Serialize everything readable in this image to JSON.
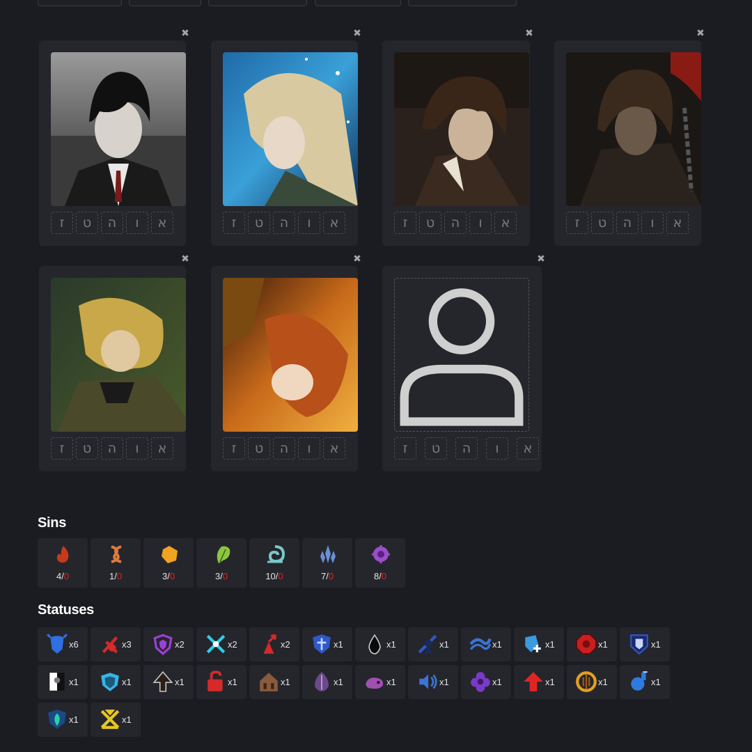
{
  "party": {
    "slot_letters": [
      "ז",
      "ט",
      "ה",
      "ו",
      "א"
    ],
    "cards": [
      {
        "name": "identity-1",
        "has_portrait": true,
        "art": "dark-suit"
      },
      {
        "name": "identity-2",
        "has_portrait": true,
        "art": "starry-blonde"
      },
      {
        "name": "identity-3",
        "has_portrait": true,
        "art": "brown-hair"
      },
      {
        "name": "identity-4",
        "has_portrait": true,
        "art": "chains"
      },
      {
        "name": "identity-5",
        "has_portrait": true,
        "art": "blonde-green"
      },
      {
        "name": "identity-6",
        "has_portrait": true,
        "art": "fire-orange"
      },
      {
        "name": "identity-7",
        "has_portrait": false,
        "art": "empty"
      }
    ]
  },
  "sins": {
    "title": "Sins",
    "items": [
      {
        "icon": "wrath-icon",
        "have": "4",
        "need": "0",
        "color": "#c6391a"
      },
      {
        "icon": "lust-icon",
        "have": "1",
        "need": "0",
        "color": "#e07a3c"
      },
      {
        "icon": "sloth-icon",
        "have": "3",
        "need": "0",
        "color": "#f0a321"
      },
      {
        "icon": "gluttony-icon",
        "have": "3",
        "need": "0",
        "color": "#8cc63f"
      },
      {
        "icon": "gloom-icon",
        "have": "10",
        "need": "0",
        "color": "#79c8c8"
      },
      {
        "icon": "pride-icon",
        "have": "7",
        "need": "0",
        "color": "#6a8fd6"
      },
      {
        "icon": "envy-icon",
        "have": "8",
        "need": "0",
        "color": "#9b4ec9"
      }
    ]
  },
  "statuses": {
    "title": "Statuses",
    "items": [
      {
        "icon": "blue-beast-icon",
        "count": "x6",
        "color": "#2f6fe0"
      },
      {
        "icon": "red-swords-icon",
        "count": "x3",
        "color": "#d42a2a"
      },
      {
        "icon": "purple-shield-icon",
        "count": "x2",
        "color": "#9b3fd6"
      },
      {
        "icon": "cyan-cross-icon",
        "count": "x2",
        "color": "#2ed0e6"
      },
      {
        "icon": "red-arrow-figure-icon",
        "count": "x2",
        "color": "#d42a2a"
      },
      {
        "icon": "blue-emblem-shield-icon",
        "count": "x1",
        "color": "#2f58c9"
      },
      {
        "icon": "ink-drop-icon",
        "count": "x1",
        "color": "#111111"
      },
      {
        "icon": "blue-slash-figure-icon",
        "count": "x1",
        "color": "#2f58c9"
      },
      {
        "icon": "blue-wave-icon",
        "count": "x1",
        "color": "#3b74d6"
      },
      {
        "icon": "shield-plus-icon",
        "count": "x1",
        "color": "#3b9ae0"
      },
      {
        "icon": "red-octagon-icon",
        "count": "x1",
        "color": "#c81f1f"
      },
      {
        "icon": "blue-crest-icon",
        "count": "x1",
        "color": "#2f58c9"
      },
      {
        "icon": "black-white-banner-icon",
        "count": "x1",
        "color": "#ffffff"
      },
      {
        "icon": "cyan-shield-icon",
        "count": "x1",
        "color": "#38b4e6"
      },
      {
        "icon": "dark-arrow-icon",
        "count": "x1",
        "color": "#3a2a1f"
      },
      {
        "icon": "red-lock-icon",
        "count": "x1",
        "color": "#d42a2a"
      },
      {
        "icon": "brown-house-icon",
        "count": "x1",
        "color": "#8a5a3c"
      },
      {
        "icon": "purple-leaf-icon",
        "count": "x1",
        "color": "#6a4a8a"
      },
      {
        "icon": "purple-ghost-icon",
        "count": "x1",
        "color": "#a050b0"
      },
      {
        "icon": "blue-sound-icon",
        "count": "x1",
        "color": "#3b74d6"
      },
      {
        "icon": "purple-flower-icon",
        "count": "x1",
        "color": "#7a3ac6"
      },
      {
        "icon": "red-up-arrow-icon",
        "count": "x1",
        "color": "#e02424"
      },
      {
        "icon": "golden-ring-icon",
        "count": "x1",
        "color": "#e0a020"
      },
      {
        "icon": "blue-potion-icon",
        "count": "x1",
        "color": "#2f7ae0"
      },
      {
        "icon": "teal-leaf-shield-icon",
        "count": "x1",
        "color": "#2aa0b0"
      },
      {
        "icon": "yellow-crossed-swords-icon",
        "count": "x1",
        "color": "#e6c820"
      }
    ]
  }
}
